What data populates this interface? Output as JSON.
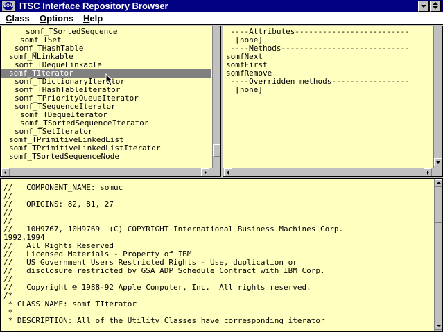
{
  "window": {
    "title": "ITSC Interface Repository Browser",
    "sysicon_text": "SOM"
  },
  "menubar": {
    "items": [
      {
        "label": "Class",
        "underline": "C",
        "rest": "lass"
      },
      {
        "label": "Options",
        "underline": "O",
        "rest": "ptions"
      },
      {
        "label": "Help",
        "underline": "H",
        "rest": "elp"
      }
    ]
  },
  "class_tree": {
    "items": [
      {
        "label": "somf_TSortedSequence",
        "indent": 4,
        "selected": false
      },
      {
        "label": "somf_TSet",
        "indent": 3,
        "selected": false
      },
      {
        "label": "somf_THashTable",
        "indent": 2,
        "selected": false
      },
      {
        "label": "somf_MLinkable",
        "indent": 1,
        "selected": false
      },
      {
        "label": "somf_TDequeLinkable",
        "indent": 2,
        "selected": false
      },
      {
        "label": "somf_TIterator",
        "indent": 1,
        "selected": true
      },
      {
        "label": "somf_TDictionaryIterator",
        "indent": 2,
        "selected": false
      },
      {
        "label": "somf_THashTableIterator",
        "indent": 2,
        "selected": false
      },
      {
        "label": "somf_TPriorityQueueIterator",
        "indent": 2,
        "selected": false
      },
      {
        "label": "somf_TSequenceIterator",
        "indent": 2,
        "selected": false
      },
      {
        "label": "somf_TDequeIterator",
        "indent": 3,
        "selected": false
      },
      {
        "label": "somf_TSortedSequenceIterator",
        "indent": 3,
        "selected": false
      },
      {
        "label": "somf_TSetIterator",
        "indent": 2,
        "selected": false
      },
      {
        "label": "somf_TPrimitiveLinkedList",
        "indent": 1,
        "selected": false
      },
      {
        "label": "somf_TPrimitiveLinkedListIterator",
        "indent": 1,
        "selected": false
      },
      {
        "label": "somf_TSortedSequenceNode",
        "indent": 1,
        "selected": false
      }
    ]
  },
  "members": {
    "lines": [
      " ----Attributes-------------------------",
      "  [none]",
      " ----Methods----------------------------",
      "somfNext",
      "somfFirst",
      "somfRemove",
      " ----Overridden methods-----------------",
      "  [none]"
    ]
  },
  "source": {
    "lines": [
      "//   COMPONENT_NAME: somuc",
      "//",
      "//   ORIGINS: 82, 81, 27",
      "//",
      "//",
      "//   10H9767, 10H9769  (C) COPYRIGHT International Business Machines Corp.",
      "1992,1994",
      "//   All Rights Reserved",
      "//   Licensed Materials - Property of IBM",
      "//   US Government Users Restricted Rights - Use, duplication or",
      "//   disclosure restricted by GSA ADP Schedule Contract with IBM Corp.",
      "//",
      "//   Copyright ® 1988-92 Apple Computer, Inc.  All rights reserved.",
      "/*",
      " * CLASS_NAME: somf_TIterator",
      " *",
      " * DESCRIPTION: All of the Utility Classes have corresponding iterator"
    ]
  },
  "colors": {
    "titlebar": "#000080",
    "pane_background": "#ffffc0",
    "selection": "#808080"
  }
}
